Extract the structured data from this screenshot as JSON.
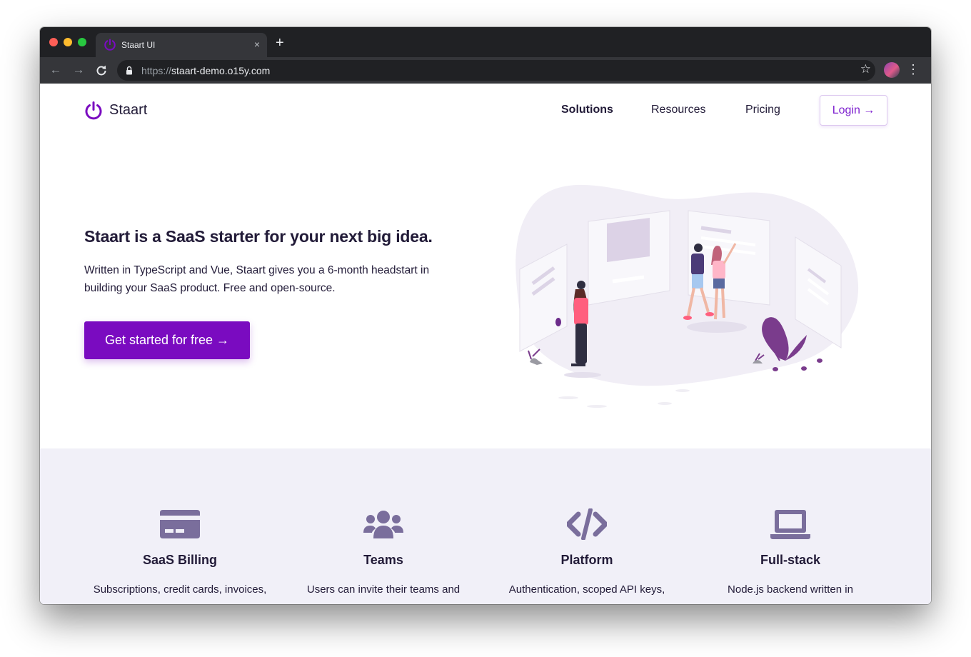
{
  "browser": {
    "tab_title": "Staart UI",
    "new_tab": "+",
    "close_tab": "×",
    "url_scheme": "https://",
    "url_host": "staart-demo.o15y.com"
  },
  "site": {
    "brand": "Staart",
    "nav": [
      {
        "label": "Solutions"
      },
      {
        "label": "Resources"
      },
      {
        "label": "Pricing"
      }
    ],
    "login_label": "Login →"
  },
  "hero": {
    "title": "Staart is a SaaS starter for your next big idea.",
    "text": "Written in TypeScript and Vue, Staart gives you a 6-month headstart in building your SaaS product. Free and open-source.",
    "cta_label": "Get started for free →"
  },
  "features": [
    {
      "icon": "credit-card-icon",
      "title": "SaaS Billing",
      "desc": "Subscriptions, credit cards, invoices,"
    },
    {
      "icon": "users-icon",
      "title": "Teams",
      "desc": "Users can invite their teams and"
    },
    {
      "icon": "code-icon",
      "title": "Platform",
      "desc": "Authentication, scoped API keys,"
    },
    {
      "icon": "laptop-icon",
      "title": "Full-stack",
      "desc": "Node.js backend written in"
    }
  ],
  "colors": {
    "accent": "#7a0bc0",
    "text": "#221b38",
    "feature_bg": "#f1f0f8",
    "feature_icon": "#7a6e9c"
  }
}
